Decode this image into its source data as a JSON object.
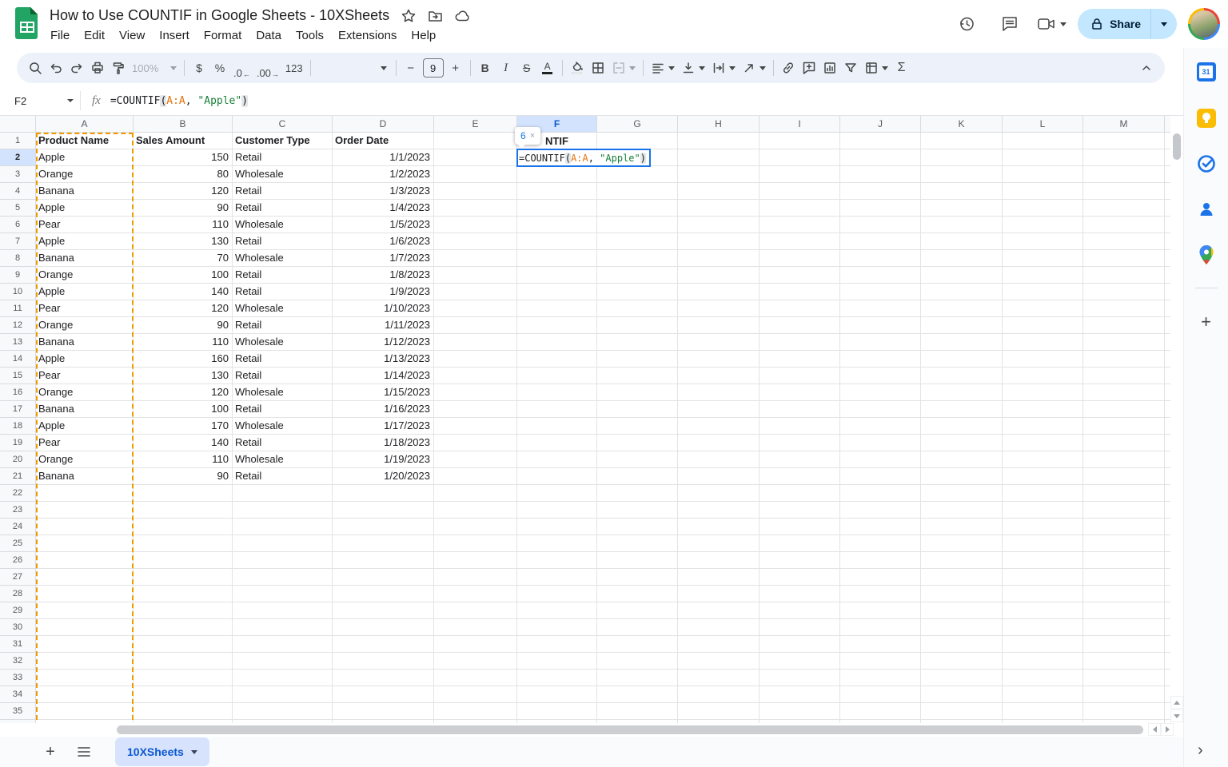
{
  "window": {
    "title": "How to Use COUNTIF in Google Sheets - 10XSheets"
  },
  "menus": [
    "File",
    "Edit",
    "View",
    "Insert",
    "Format",
    "Data",
    "Tools",
    "Extensions",
    "Help"
  ],
  "topbar_actions": {
    "share_label": "Share"
  },
  "toolbar": {
    "zoom": "100%",
    "currency": "$",
    "percent": "%",
    "decrease_decimal": ".0",
    "decrease_decimal_arrow": "←",
    "increase_decimal": ".00",
    "increase_decimal_arrow": "→",
    "more_formats": "123",
    "font_size": "9",
    "bold": "B",
    "italic": "I",
    "strikethrough": "S",
    "text_color": "A",
    "functions": "Σ"
  },
  "formula_bar": {
    "name_box": "F2",
    "tokens": [
      {
        "text": "=COUNTIF",
        "type": "plain"
      },
      {
        "text": "(",
        "type": "paren"
      },
      {
        "text": "A:A",
        "type": "range"
      },
      {
        "text": ", ",
        "type": "plain"
      },
      {
        "text": "\"Apple\"",
        "type": "string"
      },
      {
        "text": ")",
        "type": "paren"
      }
    ]
  },
  "grid": {
    "column_letters": [
      "A",
      "B",
      "C",
      "D",
      "E",
      "F",
      "G",
      "H",
      "I",
      "J",
      "K",
      "L",
      "M"
    ],
    "active_column": "F",
    "active_row": 2,
    "row_count": 35,
    "table": {
      "headers": [
        "Product Name",
        "Sales Amount",
        "Customer Type",
        "Order Date"
      ],
      "rows": [
        [
          "Apple",
          "150",
          "Retail",
          "1/1/2023"
        ],
        [
          "Orange",
          "80",
          "Wholesale",
          "1/2/2023"
        ],
        [
          "Banana",
          "120",
          "Retail",
          "1/3/2023"
        ],
        [
          "Apple",
          "90",
          "Retail",
          "1/4/2023"
        ],
        [
          "Pear",
          "110",
          "Wholesale",
          "1/5/2023"
        ],
        [
          "Apple",
          "130",
          "Retail",
          "1/6/2023"
        ],
        [
          "Banana",
          "70",
          "Wholesale",
          "1/7/2023"
        ],
        [
          "Orange",
          "100",
          "Retail",
          "1/8/2023"
        ],
        [
          "Apple",
          "140",
          "Retail",
          "1/9/2023"
        ],
        [
          "Pear",
          "120",
          "Wholesale",
          "1/10/2023"
        ],
        [
          "Orange",
          "90",
          "Retail",
          "1/11/2023"
        ],
        [
          "Banana",
          "110",
          "Wholesale",
          "1/12/2023"
        ],
        [
          "Apple",
          "160",
          "Retail",
          "1/13/2023"
        ],
        [
          "Pear",
          "130",
          "Retail",
          "1/14/2023"
        ],
        [
          "Orange",
          "120",
          "Wholesale",
          "1/15/2023"
        ],
        [
          "Banana",
          "100",
          "Retail",
          "1/16/2023"
        ],
        [
          "Apple",
          "170",
          "Wholesale",
          "1/17/2023"
        ],
        [
          "Pear",
          "140",
          "Retail",
          "1/18/2023"
        ],
        [
          "Orange",
          "110",
          "Wholesale",
          "1/19/2023"
        ],
        [
          "Banana",
          "90",
          "Retail",
          "1/20/2023"
        ]
      ]
    },
    "f1_visible_text": "NTIF",
    "result_tooltip": {
      "value": "6",
      "close": "×"
    }
  },
  "sheet_bar": {
    "active_tab": "10XSheets"
  },
  "side_panel": {
    "calendar_day": "31",
    "icons": [
      "google-calendar",
      "google-keep",
      "google-tasks",
      "google-contacts",
      "google-maps"
    ]
  },
  "colors": {
    "accent_blue": "#1a73e8",
    "selection_header_bg": "#d3e3fd",
    "selection_header_text": "#0b57d0",
    "range_token_orange": "#e8710a",
    "string_token_green": "#188038",
    "marching_ants_orange": "#f29900",
    "share_pill_bg": "#c2e7ff",
    "toolbar_bg": "#edf2fa",
    "active_tab_bg": "#d7e3fc",
    "sheets_logo_green": "#21a464"
  }
}
